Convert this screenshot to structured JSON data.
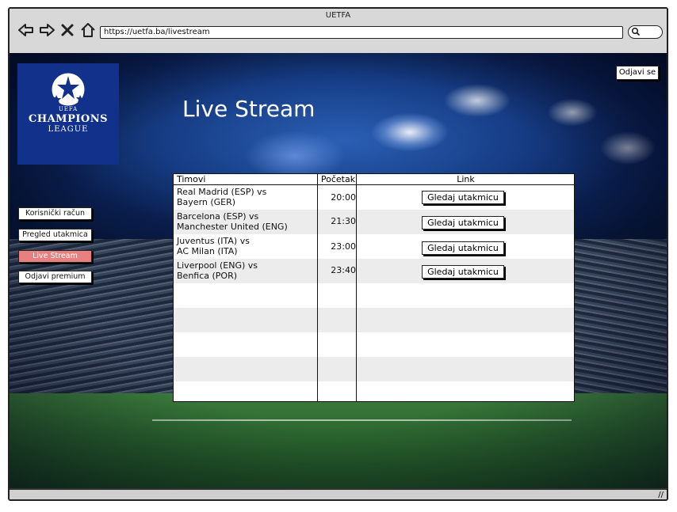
{
  "window": {
    "title": "UETFA"
  },
  "browser": {
    "url": "https://uetfa.ba/livestream"
  },
  "logo": {
    "line1": "UEFA",
    "line2": "CHAMPIONS",
    "line3": "LEAGUE"
  },
  "header": {
    "logout_label": "Odjavi se",
    "page_title": "Live Stream"
  },
  "sidebar": {
    "items": [
      {
        "label": "Korisnički račun"
      },
      {
        "label": "Pregled utakmica"
      },
      {
        "label": "Live Stream"
      },
      {
        "label": "Odjavi premium"
      }
    ]
  },
  "table": {
    "columns": [
      "Timovi",
      "Početak",
      "Link"
    ],
    "rows": [
      {
        "team_line1": "Real Madrid (ESP) vs",
        "team_line2": "Bayern (GER)",
        "time": "20:00",
        "link_label": "Gledaj utakmicu"
      },
      {
        "team_line1": "Barcelona (ESP) vs",
        "team_line2": "Manchester United (ENG)",
        "time": "21:30",
        "link_label": "Gledaj utakmicu"
      },
      {
        "team_line1": "Juventus (ITA) vs",
        "team_line2": "AC Milan (ITA)",
        "time": "23:00",
        "link_label": "Gledaj utakmicu"
      },
      {
        "team_line1": "Liverpool (ENG) vs",
        "team_line2": "Benfica (POR)",
        "time": "23:40",
        "link_label": "Gledaj utakmicu"
      }
    ]
  },
  "colors": {
    "active_menu": "#e98080",
    "logo_bg": "#12318a"
  },
  "icons": [
    "back-arrow-icon",
    "forward-arrow-icon",
    "close-icon",
    "home-icon",
    "search-icon",
    "resize-grip-icon",
    "starball-icon"
  ]
}
